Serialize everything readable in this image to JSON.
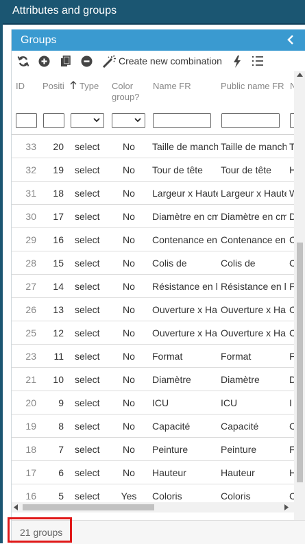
{
  "window": {
    "title": "Attributes and groups"
  },
  "panel": {
    "title": "Groups"
  },
  "toolbar": {
    "create_label": "Create new combination"
  },
  "columns": {
    "id": "ID",
    "position": "Positi",
    "type": "Type",
    "color_group": "Color group?",
    "name_fr": "Name FR",
    "public_name_fr": "Public name FR",
    "next": "Na"
  },
  "rows": [
    {
      "id": "33",
      "pos": "20",
      "type": "select",
      "color": "No",
      "name": "Taille de manch",
      "pub": "Taille de manch",
      "next": "T"
    },
    {
      "id": "32",
      "pos": "19",
      "type": "select",
      "color": "No",
      "name": "Tour de tête",
      "pub": "Tour de tête",
      "next": "H"
    },
    {
      "id": "31",
      "pos": "18",
      "type": "select",
      "color": "No",
      "name": "Largeur x Haute",
      "pub": "Largeur x Haute",
      "next": "W"
    },
    {
      "id": "30",
      "pos": "17",
      "type": "select",
      "color": "No",
      "name": "Diamètre en cm",
      "pub": "Diamètre en cm",
      "next": "D"
    },
    {
      "id": "29",
      "pos": "16",
      "type": "select",
      "color": "No",
      "name": "Contenance en",
      "pub": "Contenance en",
      "next": "C"
    },
    {
      "id": "28",
      "pos": "15",
      "type": "select",
      "color": "No",
      "name": "Colis de",
      "pub": "Colis de",
      "next": "C"
    },
    {
      "id": "27",
      "pos": "14",
      "type": "select",
      "color": "No",
      "name": "Résistance en l",
      "pub": "Résistance en l",
      "next": "F"
    },
    {
      "id": "26",
      "pos": "13",
      "type": "select",
      "color": "No",
      "name": "Ouverture x Ha",
      "pub": "Ouverture x Ha",
      "next": "C"
    },
    {
      "id": "25",
      "pos": "12",
      "type": "select",
      "color": "No",
      "name": "Ouverture x Ha",
      "pub": "Ouverture x Ha",
      "next": "C"
    },
    {
      "id": "23",
      "pos": "11",
      "type": "select",
      "color": "No",
      "name": "Format",
      "pub": "Format",
      "next": "F"
    },
    {
      "id": "21",
      "pos": "10",
      "type": "select",
      "color": "No",
      "name": "Diamètre",
      "pub": "Diamètre",
      "next": "D"
    },
    {
      "id": "20",
      "pos": "9",
      "type": "select",
      "color": "No",
      "name": "ICU",
      "pub": "ICU",
      "next": "I"
    },
    {
      "id": "19",
      "pos": "8",
      "type": "select",
      "color": "No",
      "name": "Capacité",
      "pub": "Capacité",
      "next": "C"
    },
    {
      "id": "18",
      "pos": "7",
      "type": "select",
      "color": "No",
      "name": "Peinture",
      "pub": "Peinture",
      "next": "F"
    },
    {
      "id": "17",
      "pos": "6",
      "type": "select",
      "color": "No",
      "name": "Hauteur",
      "pub": "Hauteur",
      "next": "H"
    },
    {
      "id": "16",
      "pos": "5",
      "type": "select",
      "color": "Yes",
      "name": "Coloris",
      "pub": "Coloris",
      "next": "C"
    }
  ],
  "footer": {
    "count_label": "21 groups"
  },
  "colors": {
    "title_bar": "#1b5672",
    "panel_header": "#3a9ad0",
    "highlight": "#e01818"
  }
}
